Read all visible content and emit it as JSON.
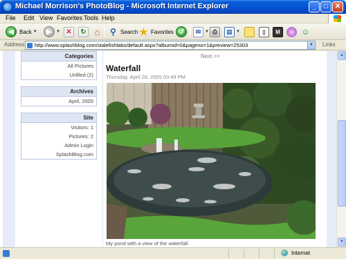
{
  "window": {
    "title": "Michael Morrison's PhotoBlog - Microsoft Internet Explorer"
  },
  "menu": [
    "File",
    "Edit",
    "View",
    "Favorites",
    "Tools",
    "Help"
  ],
  "toolbar": {
    "back_label": "Back",
    "search_label": "Search",
    "favorites_label": "Favorites"
  },
  "address": {
    "label": "Address",
    "url": "http://www.splashblog.com/stalefishlabs/default.aspx?albumid=0&pageno=1&preview=25303",
    "links_label": "Links"
  },
  "sidebar": {
    "categories": {
      "title": "Categories",
      "items": [
        "All Pictures",
        "Unfiled (2)"
      ]
    },
    "archives": {
      "title": "Archives",
      "items": [
        "April, 2005"
      ]
    },
    "site": {
      "title": "Site",
      "items": [
        "Visitors: 1",
        "Pictures: 2",
        "Admin Login",
        "SplashBlog.com"
      ]
    }
  },
  "main": {
    "next_label": "Next >>",
    "photo_title": "Waterfall",
    "photo_date": "Thursday, April 28, 2005 03:49 PM",
    "caption": "My pond with a view of the waterfall."
  },
  "status": {
    "zone": "Internet"
  }
}
